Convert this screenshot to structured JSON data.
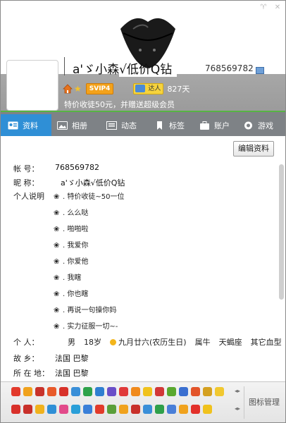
{
  "header": {
    "nickname": "a'ゞ小森√低价Q钻",
    "qq_number": "768569782",
    "svip_label": "SVIP4",
    "daren_label": "达人",
    "days": "827天",
    "promo": "特价收徒50元，并赠送超级会员"
  },
  "tabs": [
    {
      "label": "资料",
      "icon": "profile-card-icon"
    },
    {
      "label": "相册",
      "icon": "photo-album-icon"
    },
    {
      "label": "动态",
      "icon": "feed-icon"
    },
    {
      "label": "标签",
      "icon": "bookmark-icon"
    },
    {
      "label": "账户",
      "icon": "account-icon"
    },
    {
      "label": "游戏",
      "icon": "game-icon"
    }
  ],
  "profile": {
    "edit_button": "编辑资料",
    "account_label": "帐    号：",
    "account_value": "768569782",
    "nick_label": "昵    称：",
    "nick_value": "a'ゞ小森√低价Q钻",
    "bio_label": "个人说明",
    "bio_lines": [
      ". 特价收徒~50一位",
      ". 么么哒",
      ". 啪啪啦",
      ". 我爱你",
      ". 你爱他",
      ". 我瞎",
      ". 你也瞎",
      ". 再说一句操你妈",
      ". 实力征服一切~-"
    ],
    "personal_label": "个    人：",
    "gender": "男",
    "age": "18岁",
    "birthday": "九月廿六(农历生日)",
    "zodiac": "属牛",
    "constellation": "天蝎座",
    "blood": "其它血型",
    "hometown_label": "故    乡：",
    "hometown": "法国 巴黎",
    "location_label": "所 在 地：",
    "location": "法国 巴黎"
  },
  "tray": {
    "manage_label": "图标管理",
    "row1_colors": [
      "#e23a2c",
      "#f0a21d",
      "#c8332b",
      "#e85a2a",
      "#d8322a",
      "#3a8fd8",
      "#2ea24a",
      "#2f7fd0",
      "#6a4fc8",
      "#e03a3a",
      "#f08a1c",
      "#f0c21d",
      "#d23838",
      "#5aa82e",
      "#3a6fd0",
      "#e2542a",
      "#d4a020",
      "#f1c830"
    ],
    "row2_colors": [
      "#d8302a",
      "#c8302a",
      "#f0b21d",
      "#2f8fd6",
      "#e24a8a",
      "#2a9fd8",
      "#3a7fd8",
      "#e23a2a",
      "#5a9f3a",
      "#f0a21d",
      "#c8302a",
      "#3a8fd8",
      "#2fa04a",
      "#4a7fd8",
      "#f0a21d",
      "#e2302a",
      "#f0c21d"
    ]
  }
}
